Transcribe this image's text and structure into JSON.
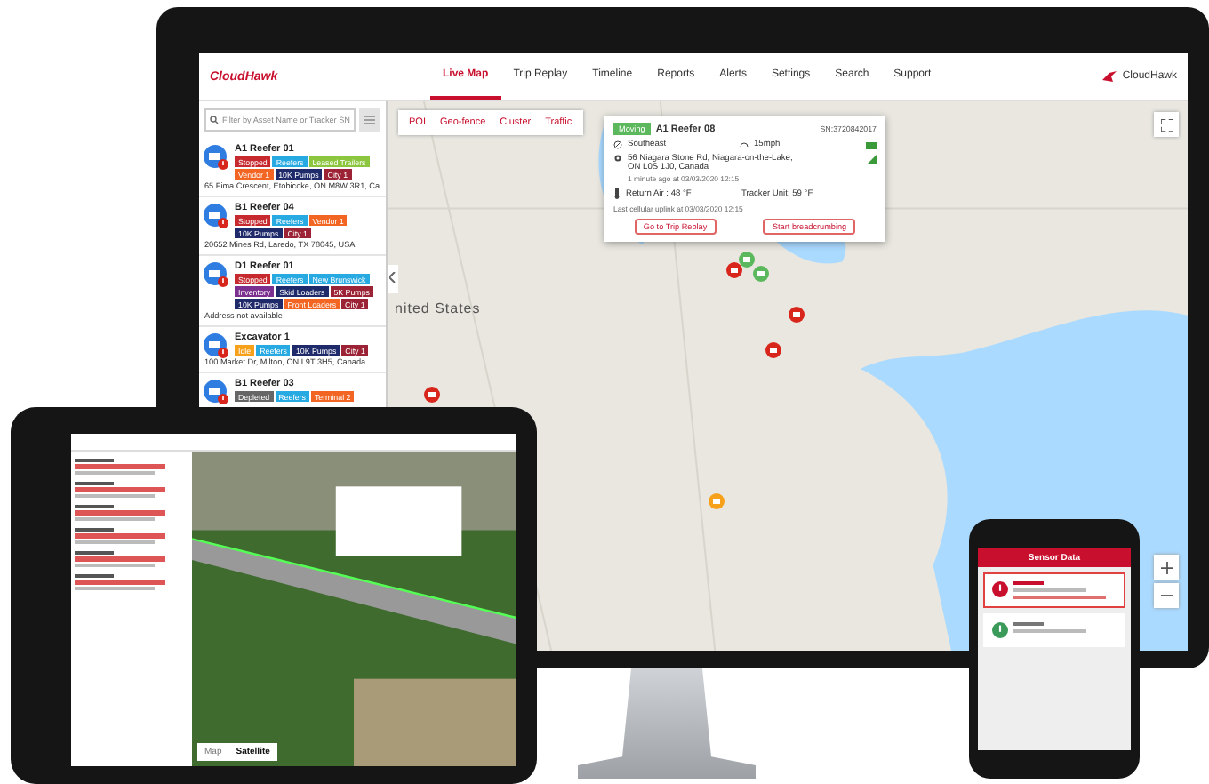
{
  "desktop": {
    "logo": "CloudHawk",
    "nav": [
      {
        "label": "Live Map",
        "selected": true
      },
      {
        "label": "Trip Replay",
        "selected": false
      },
      {
        "label": "Timeline",
        "selected": false
      },
      {
        "label": "Reports",
        "selected": false
      },
      {
        "label": "Alerts",
        "selected": false
      },
      {
        "label": "Settings",
        "selected": false
      },
      {
        "label": "Search",
        "selected": false
      },
      {
        "label": "Support",
        "selected": false
      }
    ],
    "account": "CloudHawk",
    "search": {
      "placeholder": "Filter by Asset Name or Tracker SN"
    },
    "assets": [
      {
        "name": "A1 Reefer 01",
        "tags": [
          {
            "label": "Stopped",
            "color": "#c62a2f"
          },
          {
            "label": "Reefers",
            "color": "#27a9e1"
          },
          {
            "label": "Leased Trailers",
            "color": "#8cc63f"
          },
          {
            "label": "Vendor 1",
            "color": "#f26522"
          },
          {
            "label": "10K Pumps",
            "color": "#1f2a6b"
          },
          {
            "label": "City 1",
            "color": "#9b2335"
          }
        ],
        "address": "65 Fima Crescent, Etobicoke, ON M8W 3R1, Ca..."
      },
      {
        "name": "B1 Reefer 04",
        "tags": [
          {
            "label": "Stopped",
            "color": "#c62a2f"
          },
          {
            "label": "Reefers",
            "color": "#27a9e1"
          },
          {
            "label": "Vendor 1",
            "color": "#f26522"
          },
          {
            "label": "10K Pumps",
            "color": "#1f2a6b"
          },
          {
            "label": "City 1",
            "color": "#9b2335"
          }
        ],
        "address": "20652 Mines Rd, Laredo, TX 78045, USA"
      },
      {
        "name": "D1 Reefer 01",
        "tags": [
          {
            "label": "Stopped",
            "color": "#c62a2f"
          },
          {
            "label": "Reefers",
            "color": "#27a9e1"
          },
          {
            "label": "New Brunswick",
            "color": "#27a9e1"
          },
          {
            "label": "Inventory",
            "color": "#7b2f8e"
          },
          {
            "label": "Skid Loaders",
            "color": "#1f2a6b"
          },
          {
            "label": "5K Pumps",
            "color": "#9b2335"
          },
          {
            "label": "10K Pumps",
            "color": "#1f2a6b"
          },
          {
            "label": "Front Loaders",
            "color": "#f26522"
          },
          {
            "label": "City 1",
            "color": "#9b2335"
          }
        ],
        "address": "Address not available"
      },
      {
        "name": "Excavator 1",
        "tags": [
          {
            "label": "Idle",
            "color": "#f7a11a"
          },
          {
            "label": "Reefers",
            "color": "#27a9e1"
          },
          {
            "label": "10K Pumps",
            "color": "#1f2a6b"
          },
          {
            "label": "City 1",
            "color": "#9b2335"
          }
        ],
        "address": "100 Market Dr, Milton, ON L9T 3H5, Canada"
      },
      {
        "name": "B1 Reefer 03",
        "tags": [
          {
            "label": "Depleted",
            "color": "#666666"
          },
          {
            "label": "Reefers",
            "color": "#27a9e1"
          },
          {
            "label": "Terminal 2",
            "color": "#f26522"
          }
        ]
      }
    ],
    "map_filters": [
      {
        "label": "POI",
        "selected": false
      },
      {
        "label": "Geo-fence",
        "selected": false
      },
      {
        "label": "Cluster",
        "selected": false
      },
      {
        "label": "Traffic",
        "selected": false
      }
    ],
    "map_label": "nited States",
    "popup": {
      "status": "Moving",
      "name": "A1 Reefer 08",
      "serial": "SN:3720842017",
      "heading": "Southeast",
      "speed": "15mph",
      "address": "56 Niagara Stone Rd, Niagara-on-the-Lake, ON L0S 1J0, Canada",
      "updated": "1 minute ago at 03/03/2020 12:15",
      "return_air": "Return Air : 48 °F",
      "tracker_unit": "Tracker Unit: 59 °F",
      "uplink": "Last cellular uplink at 03/03/2020 12:15",
      "buttons": [
        "Go to Trip Replay",
        "Start breadcrumbing"
      ]
    }
  },
  "tablet": {
    "map_types": [
      {
        "label": "Map",
        "selected": false
      },
      {
        "label": "Satellite",
        "selected": true
      }
    ]
  },
  "phone": {
    "title": "Sensor Data",
    "cards": [
      {
        "kind": "alert"
      },
      {
        "kind": "normal"
      }
    ]
  }
}
